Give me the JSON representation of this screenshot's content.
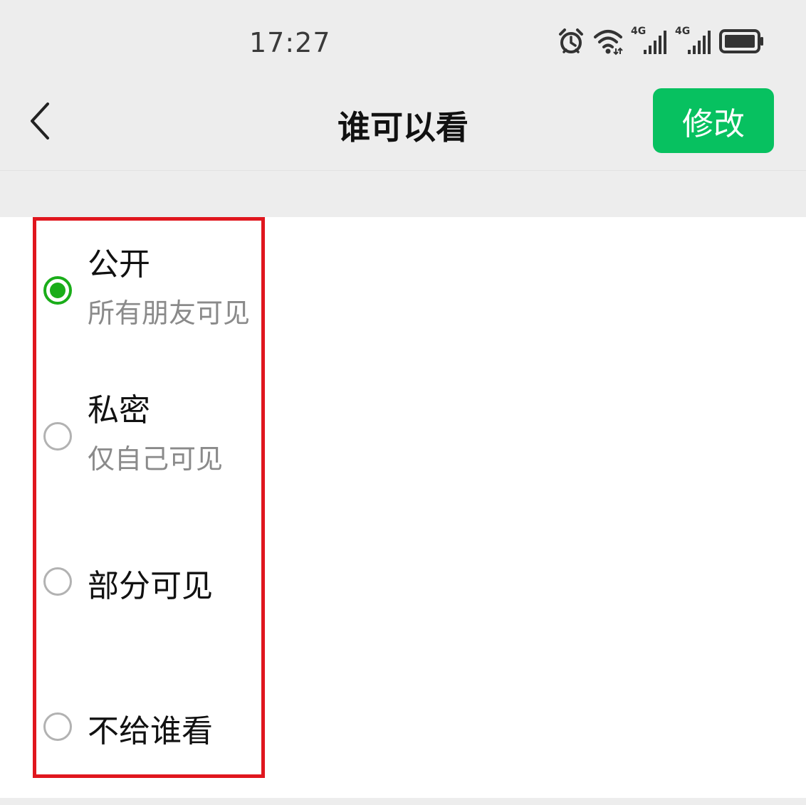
{
  "status_bar": {
    "time": "17:27",
    "icons": [
      "alarm-icon",
      "wifi-icon",
      "cellular-4g-icon",
      "cellular-4g-icon",
      "battery-icon"
    ],
    "network_label_1": "4G",
    "network_label_2": "4G"
  },
  "nav": {
    "back_icon": "chevron-left-icon",
    "title": "谁可以看",
    "modify_label": "修改"
  },
  "options": [
    {
      "title": "公开",
      "subtitle": "所有朋友可见",
      "selected": true
    },
    {
      "title": "私密",
      "subtitle": "仅自己可见",
      "selected": false
    },
    {
      "title": "部分可见",
      "subtitle": "",
      "selected": false
    },
    {
      "title": "不给谁看",
      "subtitle": "",
      "selected": false
    }
  ],
  "colors": {
    "accent": "#07c160",
    "radio_selected": "#1aad19",
    "highlight": "#e0161e",
    "header_bg": "#ededed"
  }
}
